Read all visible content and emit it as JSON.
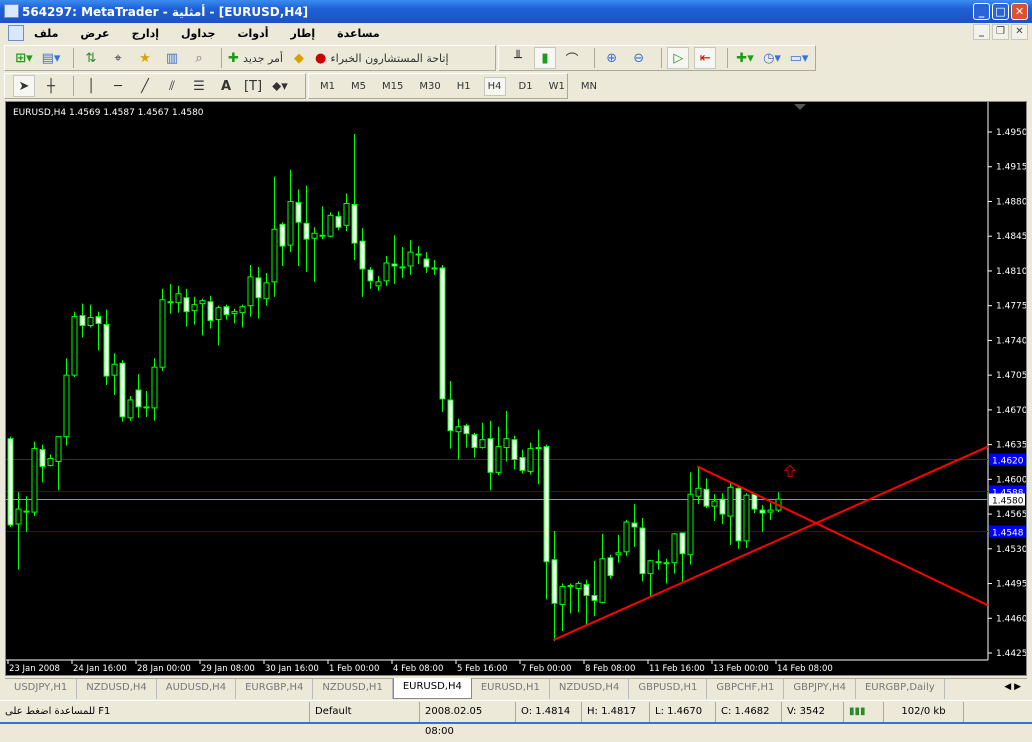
{
  "window": {
    "title": "564297: MetaTrader - أمثلية - [EURUSD,H4]"
  },
  "menu": [
    "ملف",
    "عرض",
    "إدارج",
    "جداول",
    "أدوات",
    "إطار",
    "مساعدة"
  ],
  "toolbar": {
    "new_order": "أمر جديد",
    "experts": "إتاحة المستشارون الخبراء"
  },
  "timeframes": [
    "M1",
    "M5",
    "M15",
    "M30",
    "H1",
    "H4",
    "D1",
    "W1",
    "MN"
  ],
  "active_timeframe": "H4",
  "chart_header": "EURUSD,H4  1.4569 1.4587 1.4567 1.4580",
  "colors": {
    "bull": "#00ff00",
    "bear_fill": "#ffffff",
    "hline": "#0000ff",
    "trend": "#ff0000",
    "bid": "#8899aa",
    "bg": "#000000"
  },
  "chart_data": {
    "type": "candlestick",
    "symbol": "EURUSD",
    "timeframe": "H4",
    "ylim": [
      1.4425,
      1.495
    ],
    "y_ticks": [
      "1.4950",
      "1.4915",
      "1.4880",
      "1.4845",
      "1.4810",
      "1.4775",
      "1.4740",
      "1.4705",
      "1.4670",
      "1.4635",
      "1.4600",
      "1.4565",
      "1.4530",
      "1.4495",
      "1.4460",
      "1.4425"
    ],
    "x_ticks": [
      {
        "bar": 0,
        "label": "23 Jan 2008"
      },
      {
        "bar": 8,
        "label": "24 Jan 16:00"
      },
      {
        "bar": 16,
        "label": "28 Jan 00:00"
      },
      {
        "bar": 24,
        "label": "29 Jan 08:00"
      },
      {
        "bar": 32,
        "label": "30 Jan 16:00"
      },
      {
        "bar": 40,
        "label": "1 Feb 00:00"
      },
      {
        "bar": 48,
        "label": "4 Feb 08:00"
      },
      {
        "bar": 56,
        "label": "5 Feb 16:00"
      },
      {
        "bar": 64,
        "label": "7 Feb 00:00"
      },
      {
        "bar": 72,
        "label": "8 Feb 08:00"
      },
      {
        "bar": 80,
        "label": "11 Feb 16:00"
      },
      {
        "bar": 88,
        "label": "13 Feb 00:00"
      },
      {
        "bar": 96,
        "label": "14 Feb 08:00"
      }
    ],
    "ohlc": [
      [
        1.4641,
        1.4643,
        1.4552,
        1.4554
      ],
      [
        1.4555,
        1.4587,
        1.4509,
        1.457
      ],
      [
        1.4567,
        1.4583,
        1.4547,
        1.4568
      ],
      [
        1.4567,
        1.4638,
        1.4563,
        1.4631
      ],
      [
        1.463,
        1.4635,
        1.4597,
        1.4613
      ],
      [
        1.4614,
        1.4625,
        1.4613,
        1.4621
      ],
      [
        1.4618,
        1.4643,
        1.4589,
        1.4643
      ],
      [
        1.4643,
        1.4722,
        1.4634,
        1.4705
      ],
      [
        1.4705,
        1.4769,
        1.4703,
        1.4764
      ],
      [
        1.4765,
        1.4777,
        1.4743,
        1.4755
      ],
      [
        1.4755,
        1.4776,
        1.4753,
        1.4763
      ],
      [
        1.4764,
        1.4769,
        1.473,
        1.4757
      ],
      [
        1.4756,
        1.4771,
        1.4695,
        1.4704
      ],
      [
        1.4705,
        1.4727,
        1.4685,
        1.4716
      ],
      [
        1.4717,
        1.472,
        1.4658,
        1.4663
      ],
      [
        1.4662,
        1.4684,
        1.4659,
        1.468
      ],
      [
        1.469,
        1.4706,
        1.4662,
        1.4673
      ],
      [
        1.4673,
        1.4689,
        1.4663,
        1.4672
      ],
      [
        1.4672,
        1.4722,
        1.4659,
        1.4713
      ],
      [
        1.4713,
        1.4792,
        1.4709,
        1.4781
      ],
      [
        1.4778,
        1.4797,
        1.4767,
        1.4779
      ],
      [
        1.4778,
        1.4795,
        1.4768,
        1.4787
      ],
      [
        1.4783,
        1.4792,
        1.4754,
        1.4769
      ],
      [
        1.477,
        1.4784,
        1.4756,
        1.4776
      ],
      [
        1.4777,
        1.4782,
        1.4745,
        1.478
      ],
      [
        1.4779,
        1.4785,
        1.4752,
        1.476
      ],
      [
        1.4761,
        1.4775,
        1.4735,
        1.4773
      ],
      [
        1.4774,
        1.4776,
        1.4761,
        1.4766
      ],
      [
        1.4767,
        1.4772,
        1.4757,
        1.4769
      ],
      [
        1.4768,
        1.4776,
        1.4753,
        1.4774
      ],
      [
        1.4775,
        1.4816,
        1.4764,
        1.4804
      ],
      [
        1.4803,
        1.4814,
        1.4762,
        1.4783
      ],
      [
        1.4782,
        1.4808,
        1.4775,
        1.4798
      ],
      [
        1.4799,
        1.4905,
        1.4784,
        1.4852
      ],
      [
        1.4857,
        1.4859,
        1.4815,
        1.4835
      ],
      [
        1.4836,
        1.4912,
        1.4829,
        1.488
      ],
      [
        1.4879,
        1.4892,
        1.4815,
        1.4859
      ],
      [
        1.4858,
        1.4896,
        1.4809,
        1.4842
      ],
      [
        1.4843,
        1.4854,
        1.4799,
        1.4848
      ],
      [
        1.4846,
        1.4875,
        1.4842,
        1.4846
      ],
      [
        1.4845,
        1.4869,
        1.4844,
        1.4866
      ],
      [
        1.4865,
        1.487,
        1.4851,
        1.4854
      ],
      [
        1.4856,
        1.4888,
        1.485,
        1.4878
      ],
      [
        1.4877,
        1.4948,
        1.4821,
        1.4838
      ],
      [
        1.484,
        1.4853,
        1.4784,
        1.4812
      ],
      [
        1.4811,
        1.4814,
        1.4792,
        1.48
      ],
      [
        1.4795,
        1.4805,
        1.479,
        1.4799
      ],
      [
        1.48,
        1.4825,
        1.4795,
        1.4818
      ],
      [
        1.4817,
        1.4846,
        1.4797,
        1.4815
      ],
      [
        1.4814,
        1.4834,
        1.4803,
        1.4814
      ],
      [
        1.4815,
        1.4841,
        1.4806,
        1.4829
      ],
      [
        1.4827,
        1.4835,
        1.4817,
        1.4827
      ],
      [
        1.4822,
        1.4829,
        1.4808,
        1.4814
      ],
      [
        1.4813,
        1.4821,
        1.4806,
        1.4813
      ],
      [
        1.4813,
        1.4816,
        1.4668,
        1.4681
      ],
      [
        1.468,
        1.4699,
        1.4631,
        1.4649
      ],
      [
        1.4648,
        1.4661,
        1.462,
        1.4653
      ],
      [
        1.4654,
        1.4656,
        1.4632,
        1.4646
      ],
      [
        1.4645,
        1.4647,
        1.4622,
        1.4632
      ],
      [
        1.4632,
        1.4657,
        1.4631,
        1.464
      ],
      [
        1.4641,
        1.4659,
        1.4589,
        1.4607
      ],
      [
        1.4607,
        1.4653,
        1.4604,
        1.4633
      ],
      [
        1.4632,
        1.4669,
        1.4618,
        1.4641
      ],
      [
        1.464,
        1.4644,
        1.461,
        1.462
      ],
      [
        1.4622,
        1.463,
        1.4606,
        1.4609
      ],
      [
        1.4608,
        1.4637,
        1.4605,
        1.4631
      ],
      [
        1.4632,
        1.465,
        1.4595,
        1.4632
      ],
      [
        1.4633,
        1.4635,
        1.4479,
        1.4517
      ],
      [
        1.4519,
        1.4548,
        1.4437,
        1.4475
      ],
      [
        1.4474,
        1.4495,
        1.4447,
        1.4492
      ],
      [
        1.4493,
        1.4495,
        1.4465,
        1.4493
      ],
      [
        1.449,
        1.4497,
        1.4466,
        1.4495
      ],
      [
        1.4494,
        1.4499,
        1.4453,
        1.4483
      ],
      [
        1.4483,
        1.4518,
        1.4462,
        1.4478
      ],
      [
        1.4476,
        1.4545,
        1.4475,
        1.452
      ],
      [
        1.4521,
        1.4524,
        1.45,
        1.4503
      ],
      [
        1.4524,
        1.4544,
        1.4516,
        1.4526
      ],
      [
        1.4527,
        1.4559,
        1.4523,
        1.4557
      ],
      [
        1.4556,
        1.4575,
        1.4532,
        1.4552
      ],
      [
        1.4551,
        1.4561,
        1.4497,
        1.4505
      ],
      [
        1.4505,
        1.4519,
        1.4481,
        1.4518
      ],
      [
        1.4517,
        1.4529,
        1.4509,
        1.4517
      ],
      [
        1.4516,
        1.452,
        1.4495,
        1.4516
      ],
      [
        1.4516,
        1.4546,
        1.4505,
        1.4545
      ],
      [
        1.4546,
        1.4546,
        1.4497,
        1.4525
      ],
      [
        1.4524,
        1.4607,
        1.4514,
        1.4585
      ],
      [
        1.4583,
        1.4612,
        1.4575,
        1.4591
      ],
      [
        1.459,
        1.4601,
        1.4571,
        1.4573
      ],
      [
        1.4573,
        1.4585,
        1.4558,
        1.4578
      ],
      [
        1.458,
        1.4586,
        1.4555,
        1.4565
      ],
      [
        1.4563,
        1.4596,
        1.4534,
        1.4592
      ],
      [
        1.4591,
        1.4592,
        1.453,
        1.4538
      ],
      [
        1.4538,
        1.4586,
        1.4531,
        1.4584
      ],
      [
        1.4585,
        1.4586,
        1.4566,
        1.457
      ],
      [
        1.4569,
        1.4574,
        1.4547,
        1.4566
      ],
      [
        1.4567,
        1.4576,
        1.4559,
        1.4569
      ],
      [
        1.4569,
        1.4587,
        1.4567,
        1.458
      ]
    ],
    "hlines": [
      {
        "price": 1.462,
        "label": "1.4620",
        "style": "dim"
      },
      {
        "price": 1.4588,
        "label": "1.4588",
        "style": "blue"
      },
      {
        "price": 1.458,
        "label": "1.4580",
        "style": "bid"
      },
      {
        "price": 1.4548,
        "label": "1.4548",
        "style": "blue"
      }
    ],
    "trendlines": [
      {
        "from": [
          67.9,
          1.4438
        ],
        "to": [
          122.25,
          1.4633
        ]
      },
      {
        "from": [
          85.9,
          1.4613
        ],
        "to": [
          122.25,
          1.4473
        ]
      }
    ],
    "arrow": {
      "bar": 97,
      "price": 1.4608
    }
  },
  "tabs": [
    "USDJPY,H1",
    "NZDUSD,H4",
    "AUDUSD,H4",
    "EURGBP,H4",
    "NZDUSD,H1",
    "EURUSD,H4",
    "EURUSD,H1",
    "NZDUSD,H4",
    "GBPUSD,H1",
    "GBPCHF,H1",
    "GBPJPY,H4",
    "EURGBP,Daily"
  ],
  "active_tab": "EURUSD,H4",
  "status": {
    "help": "للمساعدة اضغط على F1",
    "profile": "Default",
    "datetime": "2008.02.05 08:00",
    "open": "O: 1.4814",
    "high": "H: 1.4817",
    "low": "L: 1.4670",
    "close": "C: 1.4682",
    "volume": "V: 3542",
    "traffic": "102/0 kb"
  }
}
